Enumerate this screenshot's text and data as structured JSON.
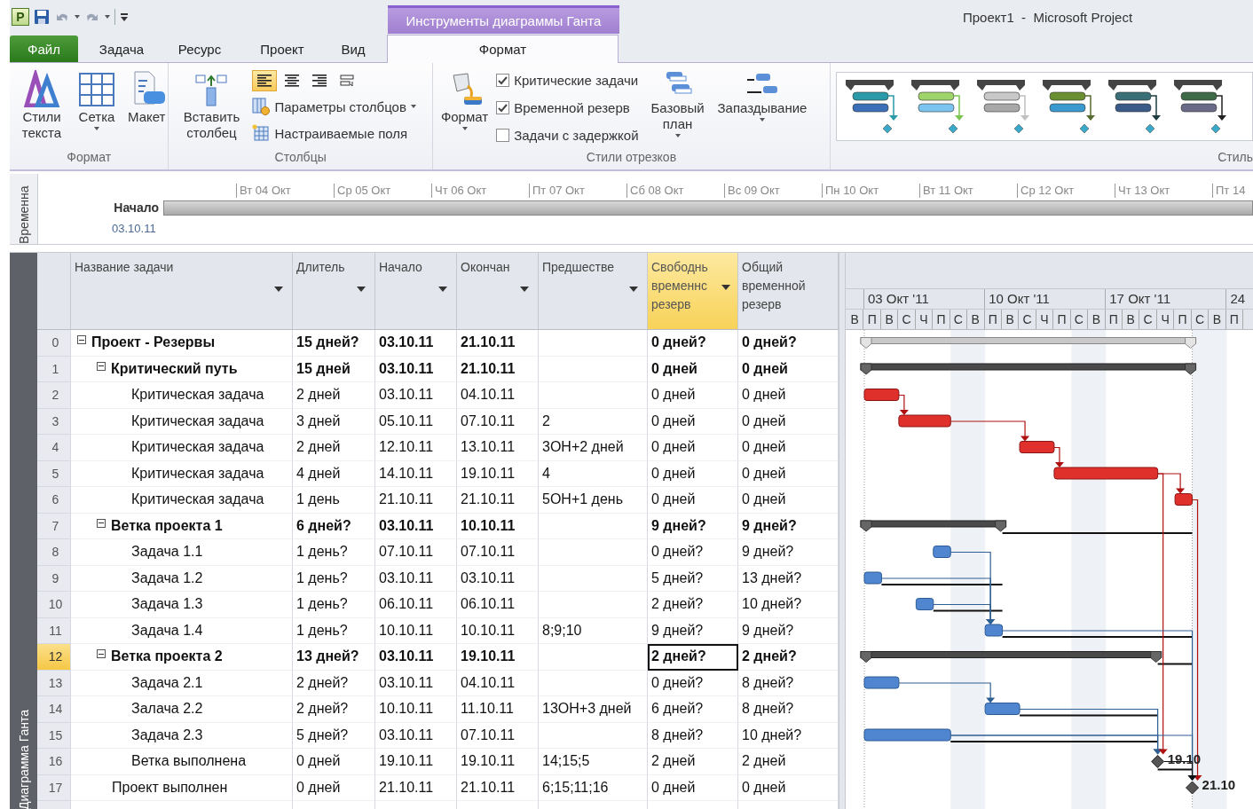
{
  "title_bar": {
    "logo_letter": "P",
    "contextual_group": "Инструменты диаграммы Ганта",
    "title": "Проект1  -  Microsoft Project"
  },
  "tabs": [
    {
      "label": "Файл",
      "kind": "file",
      "selected": false
    },
    {
      "label": "Задача",
      "kind": "tab",
      "selected": false
    },
    {
      "label": "Ресурс",
      "kind": "tab",
      "selected": false
    },
    {
      "label": "Проект",
      "kind": "tab",
      "selected": false
    },
    {
      "label": "Вид",
      "kind": "tab",
      "selected": false
    },
    {
      "label": "Формат",
      "kind": "tab",
      "selected": true
    }
  ],
  "ribbon": {
    "format_group": {
      "label": "Формат",
      "buttons": [
        {
          "label": "Стили текста",
          "has_menu": false
        },
        {
          "label": "Сетка",
          "has_menu": true
        },
        {
          "label": "Макет",
          "has_menu": false
        }
      ]
    },
    "columns_group": {
      "label": "Столбцы",
      "insert_button": "Вставить столбец",
      "align_buttons": [
        {
          "selected": true
        },
        {
          "selected": false
        },
        {
          "selected": false
        },
        {
          "selected": false
        }
      ],
      "settings_button": {
        "label": "Параметры столбцов",
        "has_menu": true
      },
      "fields_button": "Настраиваемые поля"
    },
    "bar_styles": {
      "label": "Стили отрезков",
      "format_button": {
        "label": "Формат",
        "has_menu": true
      },
      "checkboxes": [
        {
          "label": "Критические задачи",
          "checked": true
        },
        {
          "label": "Временной резерв",
          "checked": true
        },
        {
          "label": "Задачи с задержкой",
          "checked": false
        }
      ],
      "baseline_button": {
        "label": "Базовый план",
        "has_menu": true
      },
      "slippage_button": {
        "label": "Запаздывание",
        "has_menu": true
      }
    },
    "gantt_styles": {
      "label": "Стиль"
    }
  },
  "timeline": {
    "side_label": "Временна",
    "start_label": "Начало",
    "start_date": "03.10.11",
    "dates": [
      "Вт 04 Окт",
      "Ср 05 Окт",
      "Чт 06 Окт",
      "Пт 07 Окт",
      "Сб 08 Окт",
      "Вс 09 Окт",
      "Пн 10 Окт",
      "Вт 11 Окт",
      "Ср 12 Окт",
      "Чт 13 Окт",
      "Пт 14"
    ]
  },
  "table": {
    "side_label": "Диаграмма Ганта",
    "columns": [
      {
        "label": "Название задачи",
        "has_filter": true,
        "selected": false
      },
      {
        "label": "Длитель",
        "has_filter": true,
        "selected": false
      },
      {
        "label": "Начало",
        "has_filter": true,
        "selected": false
      },
      {
        "label": "Окончан",
        "has_filter": true,
        "selected": false
      },
      {
        "label": "Предшестве",
        "has_filter": true,
        "selected": false
      },
      {
        "label": "Свободнь временнс резерв",
        "has_filter": true,
        "selected": true
      },
      {
        "label": "Общий временной резерв",
        "has_filter": false,
        "selected": false
      }
    ],
    "rows": [
      {
        "id": "0",
        "name": "Проект - Резервы",
        "duration": "15 дней?",
        "start": "03.10.11",
        "finish": "21.10.11",
        "free_slack": "0 дней?",
        "total_slack": "0 дней?",
        "kind": "project",
        "expanded": true,
        "selected": false,
        "children": [
          {
            "id": "1",
            "name": "Критический путь",
            "duration": "15 дней",
            "start": "03.10.11",
            "finish": "21.10.11",
            "free_slack": "0 дней",
            "total_slack": "0 дней",
            "kind": "summary",
            "expanded": true,
            "selected": false,
            "children": [
              {
                "id": "2",
                "name": "Критическая задача",
                "duration": "2 дней",
                "start": "03.10.11",
                "finish": "04.10.11",
                "free_slack": "0 дней",
                "total_slack": "0 дней",
                "kind": "critical",
                "selected": false
              },
              {
                "id": "3",
                "name": "Критическая задача",
                "duration": "3 дней",
                "start": "05.10.11",
                "finish": "07.10.11",
                "predecessors": "2",
                "free_slack": "0 дней",
                "total_slack": "0 дней",
                "kind": "critical",
                "selected": false
              },
              {
                "id": "4",
                "name": "Критическая задача",
                "duration": "2 дней",
                "start": "12.10.11",
                "finish": "13.10.11",
                "predecessors": "3ОН+2 дней",
                "free_slack": "0 дней",
                "total_slack": "0 дней",
                "kind": "critical",
                "selected": false
              },
              {
                "id": "5",
                "name": "Критическая задача",
                "duration": "4 дней",
                "start": "14.10.11",
                "finish": "19.10.11",
                "predecessors": "4",
                "free_slack": "0 дней",
                "total_slack": "0 дней",
                "kind": "critical",
                "selected": false
              },
              {
                "id": "6",
                "name": "Критическая задача",
                "duration": "1 день",
                "start": "21.10.11",
                "finish": "21.10.11",
                "predecessors": "5ОН+1 день",
                "free_slack": "0 дней",
                "total_slack": "0 дней",
                "kind": "critical",
                "selected": false
              }
            ]
          },
          {
            "id": "7",
            "name": "Ветка проекта 1",
            "duration": "6 дней?",
            "start": "03.10.11",
            "finish": "10.10.11",
            "free_slack": "9 дней?",
            "total_slack": "9 дней?",
            "kind": "summary",
            "expanded": true,
            "selected": false,
            "children": [
              {
                "id": "8",
                "name": "Задача 1.1",
                "duration": "1 день?",
                "start": "07.10.11",
                "finish": "07.10.11",
                "free_slack": "0 дней?",
                "total_slack": "9 дней?",
                "kind": "task",
                "selected": false
              },
              {
                "id": "9",
                "name": "Задача 1.2",
                "duration": "1 день?",
                "start": "03.10.11",
                "finish": "03.10.11",
                "free_slack": "5 дней?",
                "total_slack": "13 дней?",
                "kind": "task",
                "selected": false
              },
              {
                "id": "10",
                "name": "Задача 1.3",
                "duration": "1 день?",
                "start": "06.10.11",
                "finish": "06.10.11",
                "free_slack": "2 дней?",
                "total_slack": "10 дней?",
                "kind": "task",
                "selected": false
              },
              {
                "id": "11",
                "name": "Задача 1.4",
                "duration": "1 день?",
                "start": "10.10.11",
                "finish": "10.10.11",
                "predecessors": "8;9;10",
                "free_slack": "9 дней?",
                "total_slack": "9 дней?",
                "kind": "task",
                "selected": false
              }
            ]
          },
          {
            "id": "12",
            "name": "Ветка проекта 2",
            "duration": "13 дней?",
            "start": "03.10.11",
            "finish": "19.10.11",
            "free_slack": "2 дней?",
            "total_slack": "2 дней?",
            "kind": "summary",
            "expanded": true,
            "selected": true,
            "children": [
              {
                "id": "13",
                "name": "Задача 2.1",
                "duration": "2 дней?",
                "start": "03.10.11",
                "finish": "04.10.11",
                "free_slack": "0 дней?",
                "total_slack": "8 дней?",
                "kind": "task",
                "selected": false
              },
              {
                "id": "14",
                "name": "Залача 2.2",
                "duration": "2 дней?",
                "start": "10.10.11",
                "finish": "11.10.11",
                "predecessors": "13ОН+3 дней",
                "free_slack": "6 дней?",
                "total_slack": "8 дней?",
                "kind": "task",
                "selected": false
              },
              {
                "id": "15",
                "name": "Задача 2.3",
                "duration": "5 дней?",
                "start": "03.10.11",
                "finish": "07.10.11",
                "free_slack": "8 дней?",
                "total_slack": "10 дней?",
                "kind": "task",
                "selected": false
              },
              {
                "id": "16",
                "name": "Ветка выполнена",
                "duration": "0 дней",
                "start": "19.10.11",
                "finish": "19.10.11",
                "predecessors": "14;15;5",
                "free_slack": "2 дней",
                "total_slack": "2 дней",
                "kind": "milestone",
                "bar_label": "19.10",
                "selected": false
              }
            ]
          },
          {
            "id": "17",
            "name": "Проект выполнен",
            "duration": "0 дней",
            "start": "21.10.11",
            "finish": "21.10.11",
            "predecessors": "6;15;11;16",
            "free_slack": "0 дней",
            "total_slack": "0 дней",
            "kind": "milestone",
            "bar_label": "21.10",
            "selected": false
          }
        ]
      }
    ]
  },
  "gantt": {
    "weeks": [
      "03 Окт '11",
      "10 Окт '11",
      "17 Окт '11",
      "24"
    ],
    "days": [
      "В",
      "П",
      "В",
      "С",
      "Ч",
      "П",
      "С",
      "В",
      "П",
      "В",
      "С",
      "Ч",
      "П",
      "С",
      "В",
      "П",
      "В",
      "С",
      "Ч",
      "П",
      "С",
      "В",
      "П"
    ]
  }
}
